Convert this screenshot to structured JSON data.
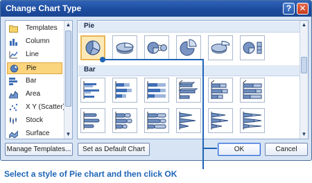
{
  "dialog": {
    "title": "Change Chart Type",
    "help_label": "?",
    "close_label": "✕"
  },
  "chart_types": [
    {
      "label": "Templates",
      "icon": "folder-icon"
    },
    {
      "label": "Column",
      "icon": "column-chart-icon"
    },
    {
      "label": "Line",
      "icon": "line-chart-icon"
    },
    {
      "label": "Pie",
      "icon": "pie-chart-icon",
      "selected": true
    },
    {
      "label": "Bar",
      "icon": "bar-chart-icon"
    },
    {
      "label": "Area",
      "icon": "area-chart-icon"
    },
    {
      "label": "X Y (Scatter)",
      "icon": "scatter-chart-icon"
    },
    {
      "label": "Stock",
      "icon": "stock-chart-icon"
    },
    {
      "label": "Surface",
      "icon": "surface-chart-icon"
    }
  ],
  "gallery": {
    "sections": [
      {
        "title": "Pie",
        "subtypes": [
          "pie",
          "pie-3d",
          "pie-of-pie",
          "exploded-pie",
          "exploded-pie-3d",
          "bar-of-pie"
        ]
      },
      {
        "title": "Bar",
        "subtypes": [
          "clustered-bar",
          "stacked-bar",
          "100-stacked-bar",
          "clustered-bar-3d",
          "stacked-bar-3d",
          "100-stacked-bar-3d"
        ]
      },
      {
        "title": "",
        "subtypes": [
          "clustered-cylinder",
          "stacked-cylinder",
          "100-stacked-cylinder",
          "clustered-cone",
          "stacked-cone",
          "100-stacked-cone"
        ]
      }
    ],
    "selected": "pie"
  },
  "buttons": {
    "manage_templates": "Manage Templates...",
    "set_default": "Set as Default Chart",
    "ok": "OK",
    "cancel": "Cancel"
  },
  "scroll_arrows": {
    "up": "▲",
    "down": "▼"
  },
  "caption": "Select a style of Pie chart and then click OK",
  "colors": {
    "accent": "#1f64b6",
    "selection": "#fbd47e",
    "titlebar": "#1d4c9f"
  }
}
